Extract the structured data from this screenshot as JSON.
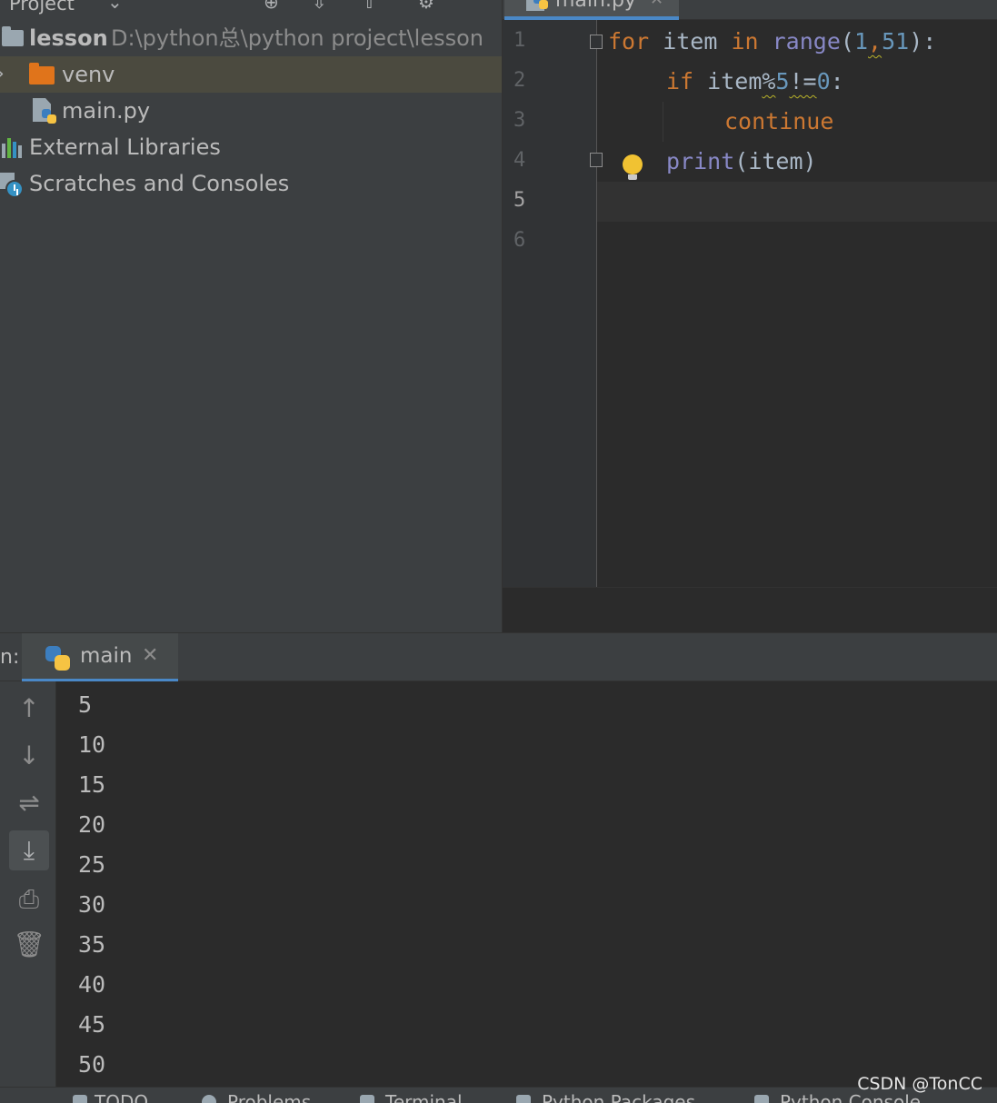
{
  "project_panel": {
    "title": "Project",
    "tree": [
      {
        "label": "lesson",
        "path": "D:\\python总\\python project\\lesson"
      },
      {
        "label": "venv"
      },
      {
        "label": "main.py"
      },
      {
        "label": "External Libraries"
      },
      {
        "label": "Scratches and Consoles"
      }
    ]
  },
  "editor": {
    "tab": {
      "label": "main.py",
      "close": "✕"
    },
    "line_numbers": [
      "1",
      "2",
      "3",
      "4",
      "5",
      "6"
    ],
    "current_line": "5",
    "code": {
      "l1": {
        "for": "for",
        "item": " item ",
        "in": "in",
        "range": " range",
        "open": "(",
        "a": "1",
        "comma": ",",
        "b": "51",
        "close": "):"
      },
      "l2": {
        "if": "if",
        "expr": " item",
        "mod": "%",
        "five": "5",
        "neq": "!=",
        "zero": "0",
        "colon": ":"
      },
      "l3": {
        "continue": "continue"
      },
      "l4": {
        "print": "print",
        "args": "(item)"
      }
    }
  },
  "run_panel": {
    "label": "n:",
    "tab": {
      "label": "main",
      "close": "✕"
    },
    "toolbar": {
      "up": "↑",
      "down": "↓",
      "wrap": "⇌",
      "scroll_end": "⤓",
      "print": "⎙",
      "trash": "🗑"
    },
    "output": [
      "5",
      "10",
      "15",
      "20",
      "25",
      "30",
      "35",
      "40",
      "45",
      "50"
    ]
  },
  "status_bar": {
    "items": [
      "TODO",
      "Problems",
      "Terminal",
      "Python Packages",
      "Python Console"
    ]
  },
  "watermark": "CSDN @TonCC",
  "colors": {
    "keyword": "#cc7832",
    "function": "#8888c6",
    "number": "#6897bb",
    "identifier": "#a9b7c6",
    "selection": "#4b4a3f",
    "accent": "#4a88c7"
  }
}
